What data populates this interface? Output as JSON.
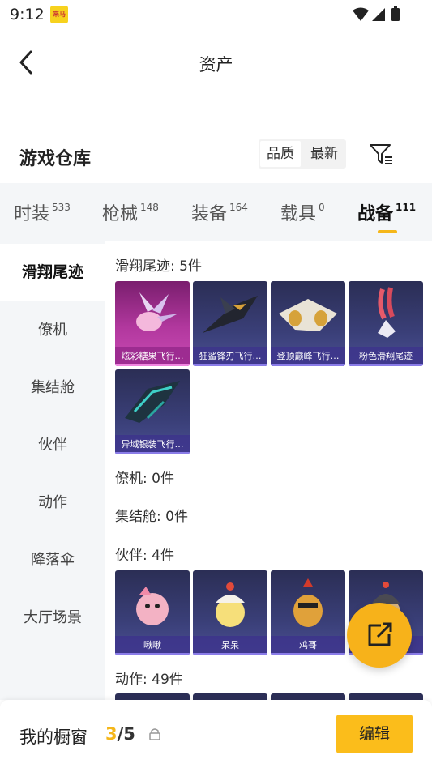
{
  "status_bar": {
    "time": "9:12",
    "app_badge": "来马"
  },
  "header": {
    "title": "资产"
  },
  "warehouse": {
    "title": "游戏仓库",
    "sort_options": [
      "品质",
      "最新"
    ],
    "filter_icon": "filter-icon"
  },
  "tabs": [
    {
      "label": "时装",
      "count": "533"
    },
    {
      "label": "枪械",
      "count": "148"
    },
    {
      "label": "装备",
      "count": "164"
    },
    {
      "label": "载具",
      "count": "0"
    },
    {
      "label": "战备",
      "count": "111"
    }
  ],
  "active_tab": "战备",
  "subnav": [
    "滑翔尾迹",
    "僚机",
    "集结舱",
    "伙伴",
    "动作",
    "降落伞",
    "大厅场景"
  ],
  "active_subnav": "滑翔尾迹",
  "sections": {
    "glide": {
      "title": "滑翔尾迹: 5件",
      "items": [
        "炫彩糖果飞行…",
        "狂鲨锋刃飞行…",
        "登顶巅峰飞行…",
        "粉色滑翔尾迹",
        "异域银装飞行…"
      ]
    },
    "wingman": {
      "title": "僚机: 0件"
    },
    "pod": {
      "title": "集结舱: 0件"
    },
    "partner": {
      "title": "伙伴: 4件",
      "items": [
        "啾啾",
        "呆呆",
        "鸡哥",
        ""
      ]
    },
    "action": {
      "title": "动作: 49件"
    }
  },
  "showcase": {
    "label": "我的橱窗",
    "current": "3",
    "total": "/5",
    "edit_label": "编辑"
  },
  "colors": {
    "accent": "#f5b71a",
    "card_bg": "#3a3f78",
    "pink_card_bg": "#b2389e"
  }
}
